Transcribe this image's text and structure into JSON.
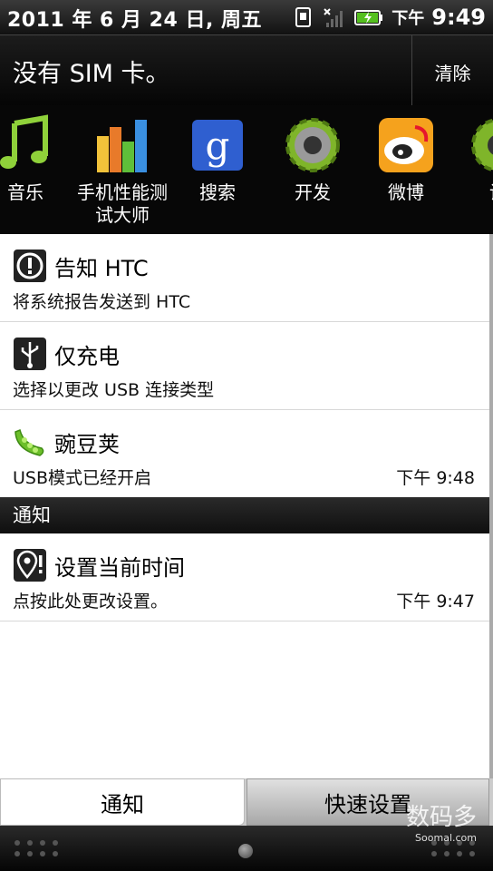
{
  "status_bar": {
    "date": "2011 年 6 月 24 日, 周五",
    "ampm": "下午",
    "time": "9:49",
    "icons": [
      "sim-icon",
      "no-signal-icon",
      "battery-charging-icon"
    ]
  },
  "sim_notice": {
    "text": "没有 SIM 卡。",
    "clear_label": "清除"
  },
  "app_strip": [
    {
      "icon": "music-note-icon",
      "label": "音乐"
    },
    {
      "icon": "benchmark-bars-icon",
      "label": "手机性能测试大师"
    },
    {
      "icon": "google-search-icon",
      "label": "搜索"
    },
    {
      "icon": "developer-gear-icon",
      "label": "开发"
    },
    {
      "icon": "weibo-icon",
      "label": "微博"
    },
    {
      "icon": "settings-partial-icon",
      "label": "设"
    }
  ],
  "ongoing": [
    {
      "icon": "alert-icon",
      "title": "告知 HTC",
      "subtitle": "将系统报告发送到 HTC",
      "time": ""
    },
    {
      "icon": "usb-icon",
      "title": "仅充电",
      "subtitle": "选择以更改 USB 连接类型",
      "time": ""
    },
    {
      "icon": "wandoujia-pea-icon",
      "title": "豌豆荚",
      "subtitle": "USB模式已经开启",
      "time": "下午 9:48"
    }
  ],
  "section_label": "通知",
  "notifications": [
    {
      "icon": "location-alert-icon",
      "title": "设置当前时间",
      "subtitle": "点按此处更改设置。",
      "time": "下午 9:47"
    }
  ],
  "tabs": {
    "notifications": "通知",
    "quick_settings": "快速设置"
  },
  "watermark": {
    "main": "数码多",
    "sub": "Soomal.com"
  },
  "colors": {
    "weibo": "#e6162d",
    "pea_green": "#6cbf2a",
    "google_blue": "#2f5fd0"
  }
}
